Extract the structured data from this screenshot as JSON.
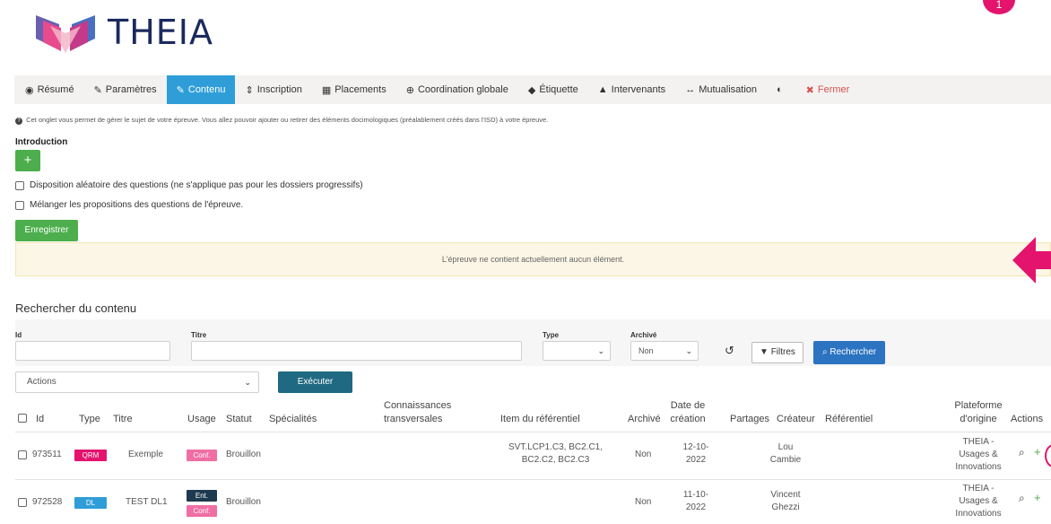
{
  "app": {
    "logo_text": "THEIA",
    "corner_badge": "1"
  },
  "tabs": [
    {
      "label": "Résumé",
      "icon": "dashboard-icon",
      "glyph": "◉"
    },
    {
      "label": "Paramètres",
      "icon": "wrench-icon",
      "glyph": "✎"
    },
    {
      "label": "Contenu",
      "icon": "edit-icon",
      "glyph": "✎",
      "active": true
    },
    {
      "label": "Inscription",
      "icon": "sort-icon",
      "glyph": "⇕"
    },
    {
      "label": "Placements",
      "icon": "grid-icon",
      "glyph": "▦"
    },
    {
      "label": "Coordination globale",
      "icon": "globe-icon",
      "glyph": "⊕"
    },
    {
      "label": "Étiquette",
      "icon": "tags-icon",
      "glyph": "◆"
    },
    {
      "label": "Intervenants",
      "icon": "user-icon",
      "glyph": "▲"
    },
    {
      "label": "Mutualisation",
      "icon": "arrows-h-icon",
      "glyph": "↔"
    },
    {
      "label": "",
      "icon": "shield-icon",
      "glyph": "◐"
    },
    {
      "label": "Fermer",
      "icon": "close-circle-icon",
      "glyph": "✖"
    }
  ],
  "info_text": "Cet onglet vous permet de gérer le sujet de votre épreuve. Vous allez pouvoir ajouter ou retirer des éléments docimologiques (préalablement créés dans l'ISD) à votre épreuve.",
  "introduction": {
    "label": "Introduction",
    "add_label": "+"
  },
  "options": {
    "random_label": "Disposition aléatoire des questions (ne s'applique pas pour les dossiers progressifs)",
    "shuffle_label": "Mélanger les propositions des questions de l'épreuve."
  },
  "save_label": "Enregistrer",
  "alert_text": "L'épreuve ne contient actuellement aucun élément.",
  "search": {
    "title": "Rechercher du contenu",
    "id_label": "Id",
    "titre_label": "Titre",
    "type_label": "Type",
    "archive_label": "Archivé",
    "archive_value": "Non",
    "filters_label": "Filtres",
    "search_label": "Rechercher"
  },
  "bulk": {
    "actions_placeholder": "Actions",
    "execute_label": "Exécuter"
  },
  "table": {
    "headers": {
      "id": "Id",
      "type": "Type",
      "titre": "Titre",
      "usage": "Usage",
      "statut": "Statut",
      "specialites": "Spécialités",
      "connaissances": "Connaissances\ntransversales",
      "item": "Item du référentiel",
      "archive": "Archivé",
      "date": "Date de\ncréation",
      "partages": "Partages",
      "createur": "Créateur",
      "referentiel": "Référentiel",
      "plateforme": "Plateforme\nd'origine",
      "actions": "Actions"
    },
    "rows": [
      {
        "id": "973511",
        "type": "QRM",
        "titre": "Exemple",
        "usage": [
          "Conf."
        ],
        "statut": "Brouillon",
        "item": "SVT.LCP1.C3, BC2.C1,\nBC2.C2, BC2.C3",
        "archive": "Non",
        "date": "12-10-\n2022",
        "createur": "Lou\nCambie",
        "plateforme": "THEIA -\nUsages &\nInnovations"
      },
      {
        "id": "972528",
        "type": "DL",
        "titre": "TEST DL1",
        "usage": [
          "Ent.",
          "Conf."
        ],
        "statut": "Brouillon",
        "item": "",
        "archive": "Non",
        "date": "11-10-\n2022",
        "createur": "Vincent\nGhezzi",
        "plateforme": "THEIA -\nUsages &\nInnovations"
      }
    ]
  },
  "colors": {
    "accent": "#2f9ed8",
    "brand_pink": "#e4136e",
    "green": "#4cae4c",
    "navy": "#1b2a5e"
  }
}
